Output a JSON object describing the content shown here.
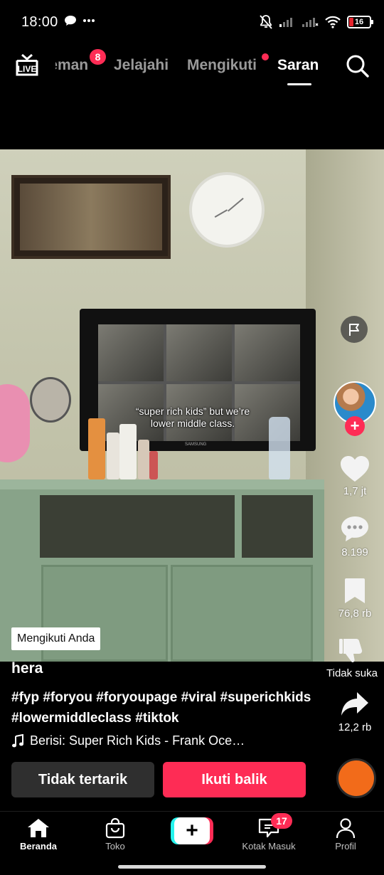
{
  "status_bar": {
    "time": "18:00",
    "battery_level": "16"
  },
  "top_nav": {
    "tabs": [
      {
        "label": "Teman",
        "badge": "8"
      },
      {
        "label": "Jelajahi"
      },
      {
        "label": "Mengikuti",
        "has_dot": true
      },
      {
        "label": "Saran",
        "active": true
      }
    ],
    "live_label": "LIVE"
  },
  "video": {
    "caption_text": "“super rich kids” but we’re lower middle class.",
    "tv_brand": "SAMSUNG",
    "follows_you_label": "Mengikuti Anda"
  },
  "actions": {
    "likes": "1,7 jt",
    "comments": "8.199",
    "saves": "76,8 rb",
    "dislike_label": "Tidak suka",
    "shares": "12,2 rb"
  },
  "post": {
    "username": "hera",
    "description": "#fyp #foryou #foryoupage #viral #superichkids #lowermiddleclass #tiktok",
    "music": "Berisi: Super Rich Kids - Frank Oce…"
  },
  "buttons": {
    "not_interested": "Tidak tertarik",
    "follow_back": "Ikuti balik"
  },
  "bottom_nav": {
    "home": "Beranda",
    "shop": "Toko",
    "inbox": "Kotak Masuk",
    "inbox_badge": "17",
    "profile": "Profil"
  },
  "colors": {
    "accent_red": "#fe2c55",
    "accent_cyan": "#25f4ee"
  }
}
